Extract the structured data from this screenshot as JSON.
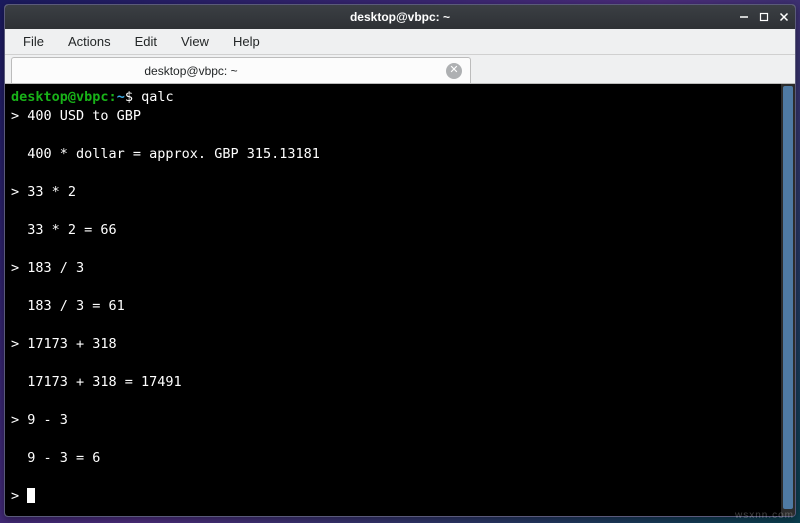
{
  "window": {
    "title": "desktop@vbpc: ~"
  },
  "menubar": {
    "items": [
      "File",
      "Actions",
      "Edit",
      "View",
      "Help"
    ]
  },
  "tab": {
    "label": "desktop@vbpc: ~"
  },
  "prompt": {
    "user_host": "desktop@vbpc",
    "sep": ":",
    "path": "~",
    "symbol": "$"
  },
  "terminal": {
    "command": "qalc",
    "lines": [
      "> 400 USD to GBP",
      "",
      "  400 * dollar = approx. GBP 315.13181",
      "",
      "> 33 * 2",
      "",
      "  33 * 2 = 66",
      "",
      "> 183 / 3",
      "",
      "  183 / 3 = 61",
      "",
      "> 17173 + 318",
      "",
      "  17173 + 318 = 17491",
      "",
      "> 9 - 3",
      "",
      "  9 - 3 = 6",
      "",
      "> "
    ]
  },
  "titlebar_buttons": {
    "minimize": "—",
    "maximize": "▫",
    "close": "✕"
  },
  "watermark": "wsxnn.com"
}
